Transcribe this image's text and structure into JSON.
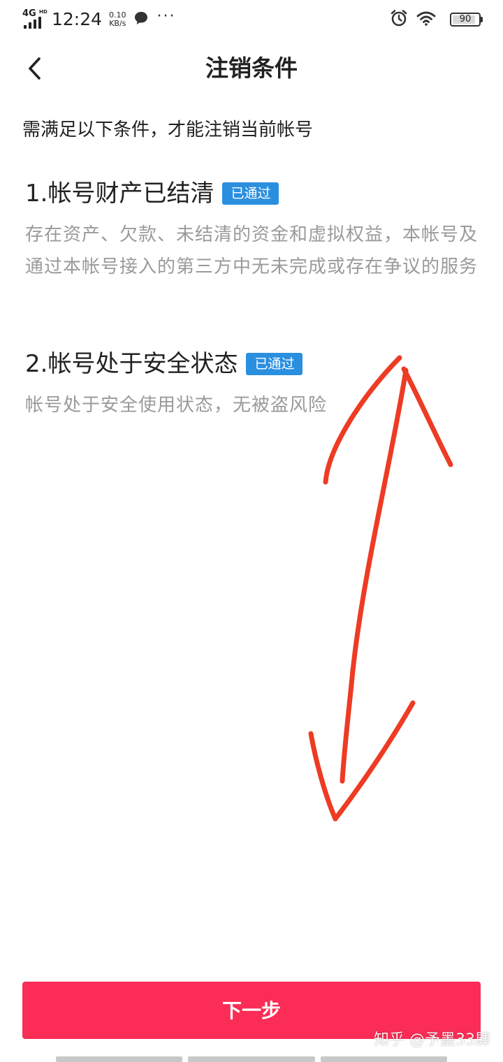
{
  "status_bar": {
    "network": "4G",
    "network_hd": "HD",
    "time": "12:24",
    "speed_value": "0.10",
    "speed_unit": "KB/s",
    "notification_dots": "···",
    "battery": "90",
    "battery_level": 0.9
  },
  "header": {
    "title": "注销条件"
  },
  "intro": "需满足以下条件，才能注销当前帐号",
  "conditions": [
    {
      "title": "1.帐号财产已结清",
      "badge": "已通过",
      "description": "存在资产、欠款、未结清的资金和虚拟权益，本帐号及通过本帐号接入的第三方中无未完成或存在争议的服务"
    },
    {
      "title": "2.帐号处于安全状态",
      "badge": "已通过",
      "description": "帐号处于安全使用状态，无被盗风险"
    }
  ],
  "next_button": "下一步",
  "watermark": "知乎 @予墨33肆",
  "colors": {
    "accent": "#fb2c55",
    "badge": "#2b8fe0",
    "muted_text": "#9a9a9a",
    "annotation": "#ee3b24"
  },
  "icons": {
    "back": "chevron-left-icon",
    "chat": "chat-bubble-icon",
    "alarm": "alarm-clock-icon",
    "wifi": "wifi-icon"
  }
}
